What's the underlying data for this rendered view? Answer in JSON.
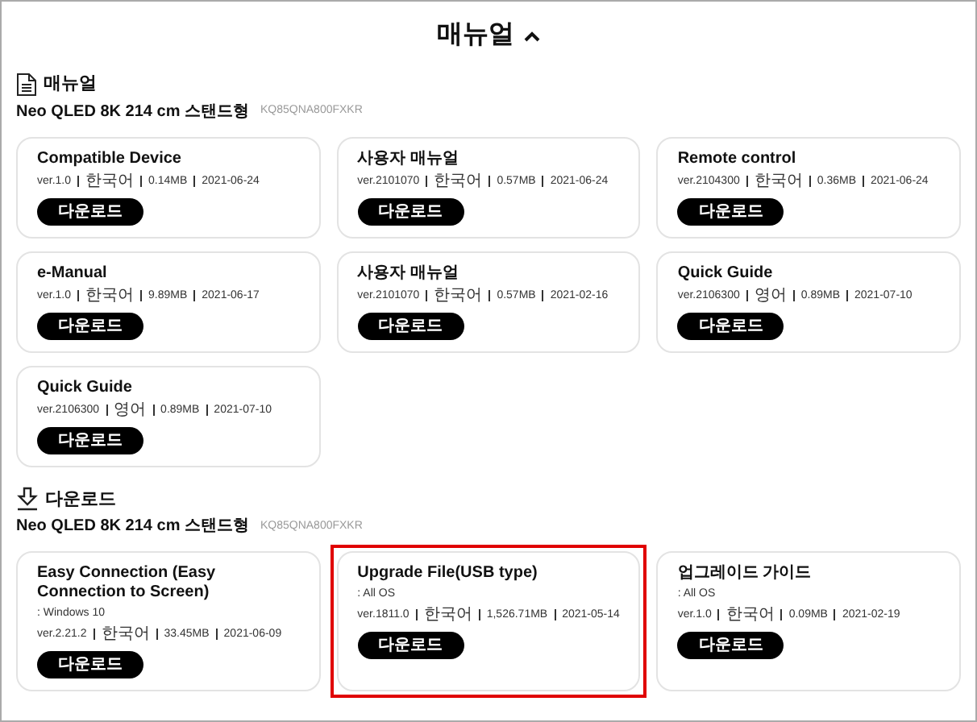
{
  "title": "매뉴얼",
  "sections": [
    {
      "kind": "document",
      "heading": "매뉴얼",
      "model": "Neo QLED 8K 214 cm 스탠드형",
      "model_code": "KQ85QNA800FXKR",
      "cards": [
        {
          "title": "Compatible Device",
          "meta": [
            "ver.1.0",
            "한국어",
            "0.14MB",
            "2021-06-24"
          ],
          "button": "다운로드",
          "highlighted": false
        },
        {
          "title": "사용자 매뉴얼",
          "meta": [
            "ver.2101070",
            "한국어",
            "0.57MB",
            "2021-06-24"
          ],
          "button": "다운로드",
          "highlighted": false
        },
        {
          "title": "Remote control",
          "meta": [
            "ver.2104300",
            "한국어",
            "0.36MB",
            "2021-06-24"
          ],
          "button": "다운로드",
          "highlighted": false
        },
        {
          "title": "e-Manual",
          "meta": [
            "ver.1.0",
            "한국어",
            "9.89MB",
            "2021-06-17"
          ],
          "button": "다운로드",
          "highlighted": false
        },
        {
          "title": "사용자 매뉴얼",
          "meta": [
            "ver.2101070",
            "한국어",
            "0.57MB",
            "2021-02-16"
          ],
          "button": "다운로드",
          "highlighted": false
        },
        {
          "title": "Quick Guide",
          "meta": [
            "ver.2106300",
            "영어",
            "0.89MB",
            "2021-07-10"
          ],
          "button": "다운로드",
          "highlighted": false
        },
        {
          "title": "Quick Guide",
          "meta": [
            "ver.2106300",
            "영어",
            "0.89MB",
            "2021-07-10"
          ],
          "button": "다운로드",
          "highlighted": false
        }
      ]
    },
    {
      "kind": "download",
      "heading": "다운로드",
      "model": "Neo QLED 8K 214 cm 스탠드형",
      "model_code": "KQ85QNA800FXKR",
      "cards": [
        {
          "title": "Easy Connection (Easy Connection to Screen)",
          "os": ": Windows 10",
          "meta": [
            "ver.2.21.2",
            "한국어",
            "33.45MB",
            "2021-06-09"
          ],
          "button": "다운로드",
          "highlighted": false
        },
        {
          "title": "Upgrade File(USB type)",
          "os": ": All OS",
          "meta": [
            "ver.1811.0",
            "한국어",
            "1,526.71MB",
            "2021-05-14"
          ],
          "button": "다운로드",
          "highlighted": true
        },
        {
          "title": "업그레이드 가이드",
          "os": ": All OS",
          "meta": [
            "ver.1.0",
            "한국어",
            "0.09MB",
            "2021-02-19"
          ],
          "button": "다운로드",
          "highlighted": false
        }
      ]
    }
  ]
}
